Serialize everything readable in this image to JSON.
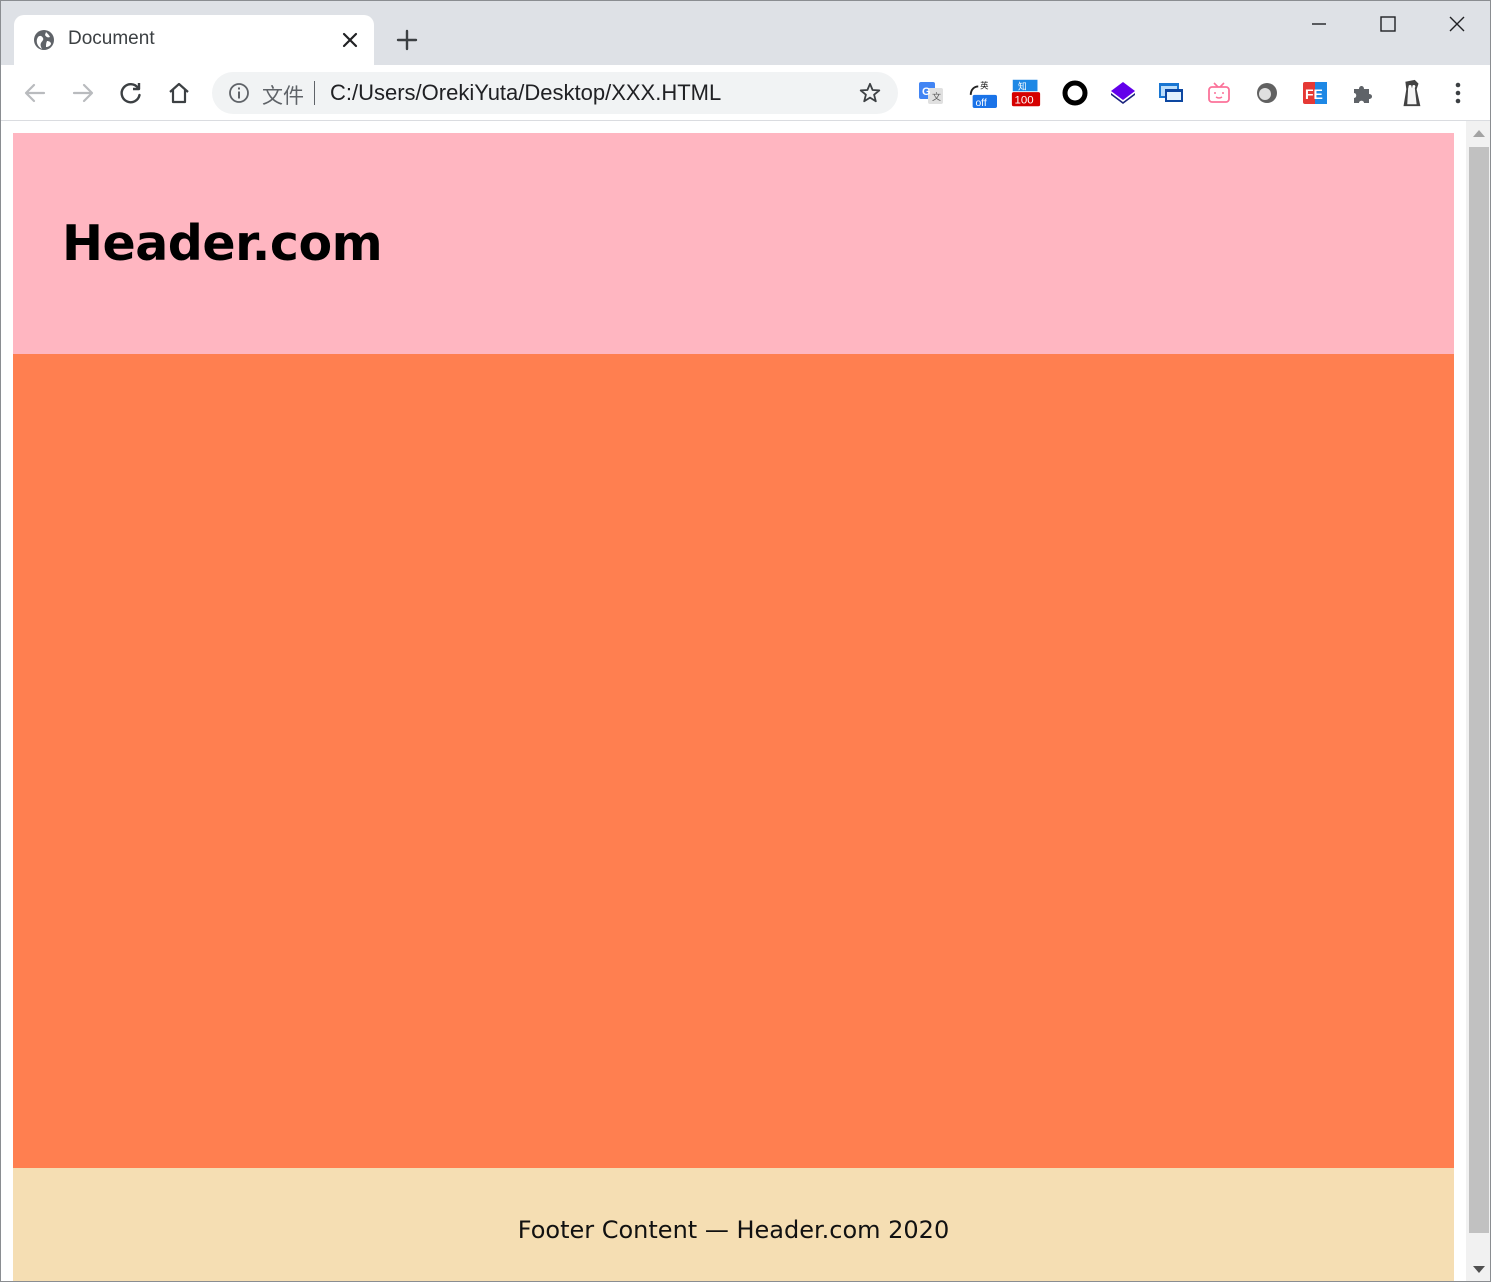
{
  "browser": {
    "tab": {
      "title": "Document",
      "favicon": "globe-icon"
    },
    "omnibox": {
      "scheme_label": "文件",
      "url": "C:/Users/OrekiYuta/Desktop/XXX.HTML"
    },
    "extensions": [
      {
        "name": "google-translate-icon"
      },
      {
        "name": "translate-off-icon",
        "badge": "off"
      },
      {
        "name": "score-100-icon",
        "badge": "100"
      },
      {
        "name": "ring-icon"
      },
      {
        "name": "stack-icon"
      },
      {
        "name": "window-capture-icon"
      },
      {
        "name": "tv-icon"
      },
      {
        "name": "circle-gray-icon"
      },
      {
        "name": "fe-icon",
        "label": "FE"
      },
      {
        "name": "puzzle-icon"
      },
      {
        "name": "avatar"
      }
    ]
  },
  "page": {
    "header_title": "Header.com",
    "footer_text": "Footer Content — Header.com 2020"
  },
  "colors": {
    "header_bg": "#ffb6c1",
    "main_bg": "#ff7f50",
    "footer_bg": "#f5deb3"
  }
}
